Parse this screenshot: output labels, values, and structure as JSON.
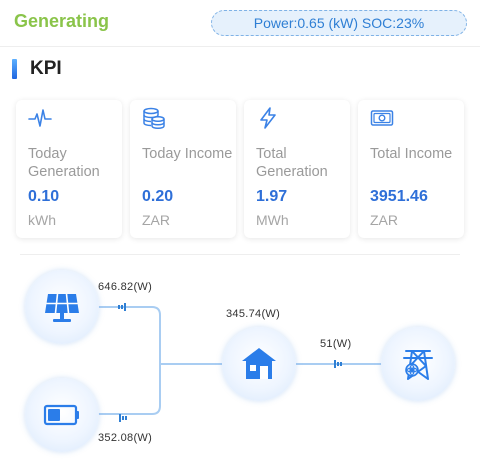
{
  "header": {
    "status": "Generating",
    "power_soc": "Power:0.65 (kW)   SOC:23%",
    "status_color": "#8ac44a",
    "accent_color": "#2e6fd8"
  },
  "section": {
    "title": "KPI"
  },
  "kpis": [
    {
      "icon": "pulse-icon",
      "label": "Today Generation",
      "value": "0.10",
      "unit": "kWh"
    },
    {
      "icon": "coins-icon",
      "label": "Today Income",
      "value": "0.20",
      "unit": "ZAR"
    },
    {
      "icon": "bolt-icon",
      "label": "Total Generation",
      "value": "1.97",
      "unit": "MWh"
    },
    {
      "icon": "cash-icon",
      "label": "Total Income",
      "value": "3951.46",
      "unit": "ZAR"
    }
  ],
  "flow": {
    "pv_power": "646.82(W)",
    "battery_power": "352.08(W)",
    "home_power": "345.74(W)",
    "grid_power": "51(W)",
    "nodes": {
      "pv": "solar-panel-icon",
      "battery": "battery-icon",
      "home": "home-icon",
      "grid": "grid-tower-icon"
    }
  }
}
